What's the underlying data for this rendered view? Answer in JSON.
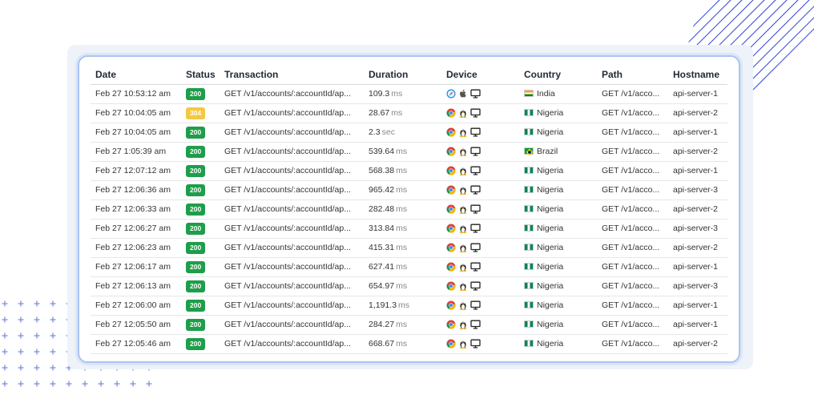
{
  "table": {
    "headers": [
      "Date",
      "Status",
      "Transaction",
      "Duration",
      "Device",
      "Country",
      "Path",
      "Hostname"
    ],
    "rows": [
      {
        "date": "Feb 27 10:53:12 am",
        "status": "200",
        "status_type": "ok",
        "transaction": "GET /v1/accounts/:accountId/ap...",
        "duration": "109.3",
        "unit": "ms",
        "device": "safari-mac",
        "flag": "in",
        "country": "India",
        "path": "GET /v1/acco...",
        "hostname": "api-server-1"
      },
      {
        "date": "Feb 27 10:04:05 am",
        "status": "304",
        "status_type": "warn",
        "transaction": "GET /v1/accounts/:accountId/ap...",
        "duration": "28.67",
        "unit": "ms",
        "device": "chrome-linux",
        "flag": "ng",
        "country": "Nigeria",
        "path": "GET /v1/acco...",
        "hostname": "api-server-2"
      },
      {
        "date": "Feb 27 10:04:05 am",
        "status": "200",
        "status_type": "ok",
        "transaction": "GET /v1/accounts/:accountId/ap...",
        "duration": "2.3",
        "unit": "sec",
        "device": "chrome-linux",
        "flag": "ng",
        "country": "Nigeria",
        "path": "GET /v1/acco...",
        "hostname": "api-server-1"
      },
      {
        "date": "Feb 27 1:05:39 am",
        "status": "200",
        "status_type": "ok",
        "transaction": "GET /v1/accounts/:accountId/ap...",
        "duration": "539.64",
        "unit": "ms",
        "device": "chrome-linux",
        "flag": "br",
        "country": "Brazil",
        "path": "GET /v1/acco...",
        "hostname": "api-server-2"
      },
      {
        "date": "Feb 27 12:07:12 am",
        "status": "200",
        "status_type": "ok",
        "transaction": "GET /v1/accounts/:accountId/ap...",
        "duration": "568.38",
        "unit": "ms",
        "device": "chrome-linux",
        "flag": "ng",
        "country": "Nigeria",
        "path": "GET /v1/acco...",
        "hostname": "api-server-1"
      },
      {
        "date": "Feb 27 12:06:36 am",
        "status": "200",
        "status_type": "ok",
        "transaction": "GET /v1/accounts/:accountId/ap...",
        "duration": "965.42",
        "unit": "ms",
        "device": "chrome-linux",
        "flag": "ng",
        "country": "Nigeria",
        "path": "GET /v1/acco...",
        "hostname": "api-server-3"
      },
      {
        "date": "Feb 27 12:06:33 am",
        "status": "200",
        "status_type": "ok",
        "transaction": "GET /v1/accounts/:accountId/ap...",
        "duration": "282.48",
        "unit": "ms",
        "device": "chrome-linux",
        "flag": "ng",
        "country": "Nigeria",
        "path": "GET /v1/acco...",
        "hostname": "api-server-2"
      },
      {
        "date": "Feb 27 12:06:27 am",
        "status": "200",
        "status_type": "ok",
        "transaction": "GET /v1/accounts/:accountId/ap...",
        "duration": "313.84",
        "unit": "ms",
        "device": "chrome-linux",
        "flag": "ng",
        "country": "Nigeria",
        "path": "GET /v1/acco...",
        "hostname": "api-server-3"
      },
      {
        "date": "Feb 27 12:06:23 am",
        "status": "200",
        "status_type": "ok",
        "transaction": "GET /v1/accounts/:accountId/ap...",
        "duration": "415.31",
        "unit": "ms",
        "device": "chrome-linux",
        "flag": "ng",
        "country": "Nigeria",
        "path": "GET /v1/acco...",
        "hostname": "api-server-2"
      },
      {
        "date": "Feb 27 12:06:17 am",
        "status": "200",
        "status_type": "ok",
        "transaction": "GET /v1/accounts/:accountId/ap...",
        "duration": "627.41",
        "unit": "ms",
        "device": "chrome-linux",
        "flag": "ng",
        "country": "Nigeria",
        "path": "GET /v1/acco...",
        "hostname": "api-server-1"
      },
      {
        "date": "Feb 27 12:06:13 am",
        "status": "200",
        "status_type": "ok",
        "transaction": "GET /v1/accounts/:accountId/ap...",
        "duration": "654.97",
        "unit": "ms",
        "device": "chrome-linux",
        "flag": "ng",
        "country": "Nigeria",
        "path": "GET /v1/acco...",
        "hostname": "api-server-3"
      },
      {
        "date": "Feb 27 12:06:00 am",
        "status": "200",
        "status_type": "ok",
        "transaction": "GET /v1/accounts/:accountId/ap...",
        "duration": "1,191.3",
        "unit": "ms",
        "device": "chrome-linux",
        "flag": "ng",
        "country": "Nigeria",
        "path": "GET /v1/acco...",
        "hostname": "api-server-1"
      },
      {
        "date": "Feb 27 12:05:50 am",
        "status": "200",
        "status_type": "ok",
        "transaction": "GET /v1/accounts/:accountId/ap...",
        "duration": "284.27",
        "unit": "ms",
        "device": "chrome-linux",
        "flag": "ng",
        "country": "Nigeria",
        "path": "GET /v1/acco...",
        "hostname": "api-server-1"
      },
      {
        "date": "Feb 27 12:05:46 am",
        "status": "200",
        "status_type": "ok",
        "transaction": "GET /v1/accounts/:accountId/ap...",
        "duration": "668.67",
        "unit": "ms",
        "device": "chrome-linux",
        "flag": "ng",
        "country": "Nigeria",
        "path": "GET /v1/acco...",
        "hostname": "api-server-2"
      }
    ]
  },
  "colors": {
    "status_ok": "#1e9e4a",
    "status_warn": "#f5c842",
    "card_border": "#a9c4f2",
    "panel_bg": "#eef2f9",
    "deco": "#3b4fd6"
  }
}
